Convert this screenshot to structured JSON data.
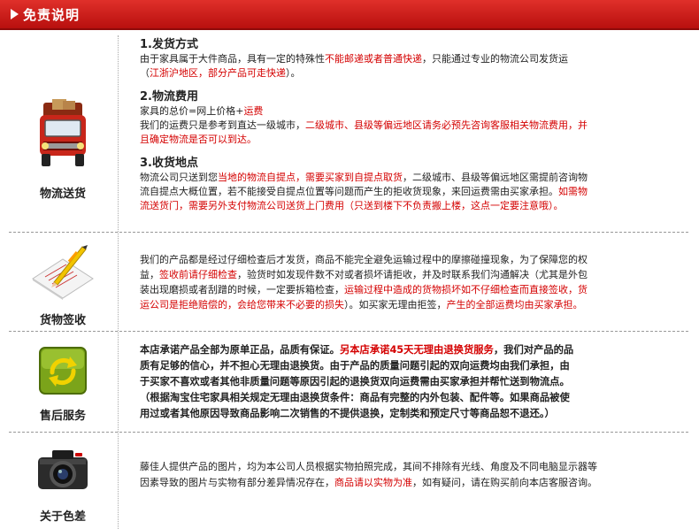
{
  "header": {
    "title": "免责说明"
  },
  "sections": {
    "shipping": {
      "label": "物流送货",
      "items": [
        {
          "heading": "1.发货方式",
          "p1": "由于家具属于大件商品，具有一定的特殊性",
          "p1_red": "不能邮递或者普通快递",
          "p1_end": "，只能通过专业的物流公司发货运",
          "p2_open": "（",
          "p2_red": "江浙沪地区，部分产品可走快递",
          "p2_close": "）。"
        },
        {
          "heading": "2.物流费用",
          "l1": "家具的总价=网上价格+",
          "l1_red": "运费",
          "l2": "我们的运费只是参考到直达一级城市，",
          "l2_red": "二级城市、县级等偏远地区请务必预先咨询客服相关物流费用，并",
          "l3_red": "且确定物流是否可以到达。"
        },
        {
          "heading": "3.收货地点",
          "a": "物流公司只送到您",
          "b_red": "当地的物流自提点，需要买家到自提点取货",
          "c": "，二级城市、县级等偏远地区需提前咨询物",
          "d": "流自提点大概位置，若不能接受自提点位置等问题而产生的拒收货现象，来回运费需由买家承担。",
          "e_red": "如需物",
          "f_red": "流送货门，需要另外支付物流公司送货上门费用（只送到楼下不负责搬上楼，这点一定要注意哦）。"
        }
      ]
    },
    "signing": {
      "label": "货物签收",
      "t1": "我们的产品都是经过仔细检查后才发货，商品不能完全避免运输过程中的摩擦碰撞现象，为了保障您的权",
      "t2a": "益，",
      "t2b_red": "签收前请仔细检查",
      "t2c": "，验货时如发现件数不对或者损坏请拒收，并及时联系我们沟通解决（尤其是外包",
      "t3a": "装出现磨损或者刮蹭的时候，一定要拆箱检查，",
      "t3b_red": "运输过程中造成的货物损坏如不仔细检查而直接签收，货",
      "t4a_red": "运公司是拒绝赔偿的，会给您带来不必要的损失",
      "t4b": "）。如买家无理由拒签，",
      "t4c_red": "产生的全部运费均由买家承担。"
    },
    "aftersales": {
      "label": "售后服务",
      "t1a": "本店承诺产品全部为原单正品，品质有保证。",
      "t1b_red": "另本店承诺45天无理由退换货服务",
      "t1c": "，我们对产品的品",
      "t2": "质有足够的信心，并不担心无理由退换货。由于产品的质量问题引起的双向运费均由我们承担，由",
      "t3": "于买家不喜欢或者其他非质量问题等原因引起的退换货双向运费需由买家承担并帮忙送到物流点。",
      "t4": "（根据淘宝住宅家具相关规定无理由退换货条件：商品有完整的内外包装、配件等。如果商品被使",
      "t5": "用过或者其他原因导致商品影响二次销售的不提供退换，定制类和预定尺寸等商品恕不退还。）"
    },
    "color": {
      "label": "关于色差",
      "t1": "藤佳人提供产品的图片，均为本公司人员根据实物拍照完成，其间不排除有光线、角度及不同电脑显示器等",
      "t2a": "因素导致的图片与实物有部分差异情况存在，",
      "t2b_red": "商品请以实物为准",
      "t2c": "，如有疑问，请在购买前向本店客服咨询。"
    }
  },
  "icons": {
    "shipping": "delivery-truck-icon",
    "signing": "document-pen-icon",
    "aftersales": "refresh-arrows-icon",
    "color": "camera-icon"
  }
}
